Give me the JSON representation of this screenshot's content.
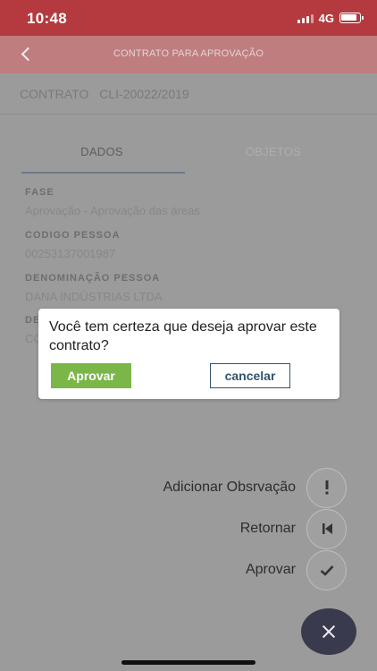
{
  "status_bar": {
    "time": "10:48",
    "network": "4G"
  },
  "header": {
    "title": "CONTRATO PARA APROVAÇÃO"
  },
  "contract": {
    "label": "CONTRATO",
    "number": "CLI-20022/2019"
  },
  "tabs": [
    {
      "label": "DADOS",
      "active": true
    },
    {
      "label": "OBJETOS",
      "active": false
    }
  ],
  "fields": {
    "fase": {
      "label": "FASE",
      "value": "Aprovação - Aprovação das áreas"
    },
    "codigo": {
      "label": "CODIGO PESSOA",
      "value": "00253137001987"
    },
    "denominacao": {
      "label": "DENOMINAÇÃO PESSOA",
      "value": "DANA INDÚSTRIAS LTDA"
    },
    "partial_label": "DE",
    "partial_value": "CO"
  },
  "dialog": {
    "message": "Você tem certeza que deseja aprovar este contrato?",
    "approve_label": "Aprovar",
    "cancel_label": "cancelar"
  },
  "actions": {
    "add_note": "Adicionar Obsrvação",
    "return": "Retornar",
    "approve": "Aprovar"
  },
  "icons": {
    "back": "chevron-left-icon",
    "exclamation": "exclamation-icon",
    "skip_back": "skip-back-icon",
    "check": "check-icon",
    "close": "close-icon"
  },
  "colors": {
    "status_bar": "#b43a3f",
    "approve_button": "#7ab648",
    "cancel_button_border": "#33536e",
    "fab": "#3a3a4f"
  }
}
